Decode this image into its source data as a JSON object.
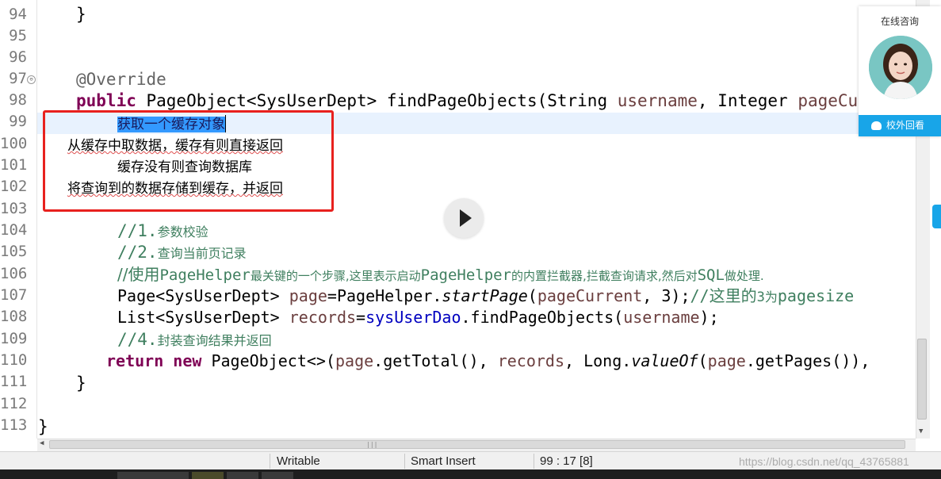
{
  "editor": {
    "lines": [
      {
        "num": "94",
        "text": "}"
      },
      {
        "num": "95",
        "text": ""
      },
      {
        "num": "96",
        "text": ""
      },
      {
        "num": "97",
        "annotation": "@Override"
      },
      {
        "num": "98",
        "kw": "public",
        "rest1": " PageObject<SysUserDept> findPageObjects(String ",
        "param1": "username",
        "rest2": ", Integer ",
        "param2": "pageCu"
      },
      {
        "num": "99",
        "text": "获取一个缓存对象"
      },
      {
        "num": "100",
        "text": "从缓存中取数据，缓存有则直接返回"
      },
      {
        "num": "101",
        "text": "缓存没有则查询数据库"
      },
      {
        "num": "102",
        "text": "将查询到的数据存储到缓存，并返回"
      },
      {
        "num": "103",
        "text": ""
      },
      {
        "num": "104",
        "cmt_prefix": "//1.",
        "cmt_text": "参数校验"
      },
      {
        "num": "105",
        "cmt_prefix": "//2.",
        "cmt_text": "查询当前页记录"
      },
      {
        "num": "106",
        "cmt_a": "//使用",
        "cmt_b": "PageHelper",
        "cmt_c": "最关键的一个步骤,这里表示启动",
        "cmt_d": "PageHelper",
        "cmt_e": "的内置拦截器,拦截查询请求,然后对",
        "cmt_f": "SQL",
        "cmt_g": "做处理."
      },
      {
        "num": "107",
        "p1": "Page<SysUserDept> ",
        "var": "page",
        "p2": "=PageHelper.",
        "method": "startPage",
        "p3": "(",
        "arg": "pageCurrent",
        "p4": ", 3);",
        "c1": "//这里的",
        "c2": "3",
        "c3": "为",
        "c4": "pagesize"
      },
      {
        "num": "108",
        "p1": "List<SysUserDept> ",
        "var": "records",
        "p2": "=",
        "field": "sysUserDao",
        "p3": ".findPageObjects(",
        "arg": "username",
        "p4": ");"
      },
      {
        "num": "109",
        "cmt_prefix": "//4.",
        "cmt_text": "封装查询结果并返回"
      },
      {
        "num": "110",
        "kw1": "return",
        "sp": " ",
        "kw2": "new",
        "p1": " PageObject<>(",
        "a1": "page",
        "p2": ".getTotal(), ",
        "a2": "records",
        "p3": ", Long.",
        "method": "valueOf",
        "p4": "(",
        "a3": "page",
        "p5": ".getPages()),"
      },
      {
        "num": "111",
        "text": "}"
      },
      {
        "num": "112",
        "text": ""
      },
      {
        "num": "113",
        "text": "}"
      }
    ]
  },
  "status": {
    "mode": "Writable",
    "insert": "Smart Insert",
    "position": "99 : 17 [8]"
  },
  "watermark": "https://blog.csdn.net/qq_43765881",
  "chat": {
    "title": "在线咨询",
    "button": "校外回看"
  },
  "colors": {
    "keyword": "#7f0055",
    "comment": "#3f7f5f",
    "field": "#0000c0",
    "parameter": "#6a3e3e",
    "highlight_box": "#e8211e",
    "selection": "#3399ff",
    "chat_accent": "#18a5e8"
  }
}
